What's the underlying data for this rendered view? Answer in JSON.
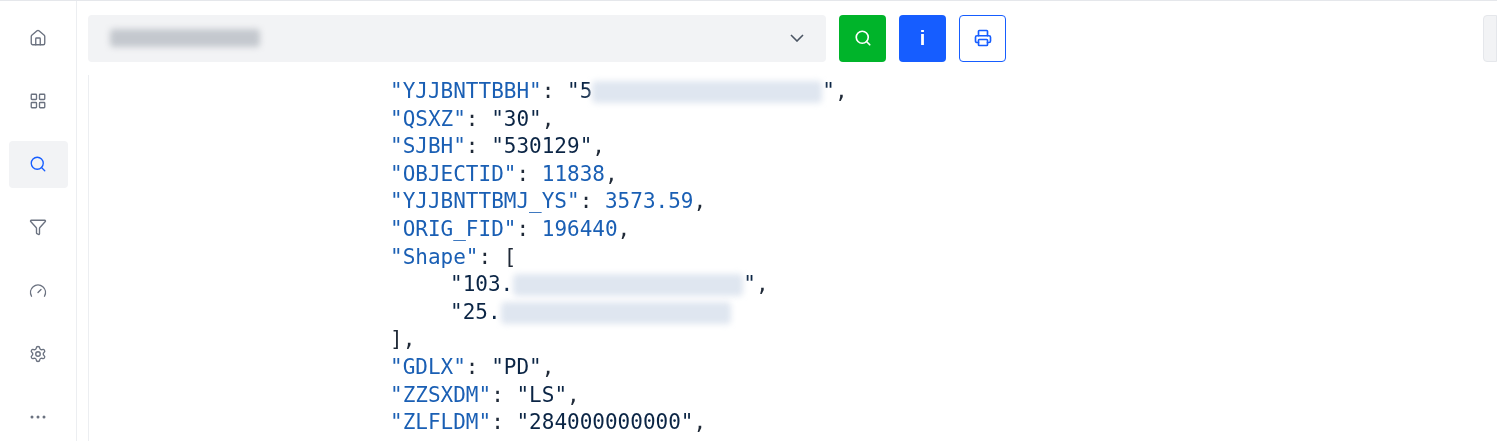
{
  "sidebar": {
    "items": [
      {
        "kind": "home",
        "selected": false
      },
      {
        "kind": "grid",
        "selected": false
      },
      {
        "kind": "search",
        "selected": true
      },
      {
        "kind": "filter",
        "selected": false
      },
      {
        "kind": "gauge",
        "selected": false
      },
      {
        "kind": "settings",
        "selected": false
      },
      {
        "kind": "more",
        "selected": false
      }
    ]
  },
  "toolbar": {
    "select": {
      "redacted": true
    },
    "buttons": [
      {
        "kind": "search"
      },
      {
        "kind": "info",
        "label": "i"
      },
      {
        "kind": "print"
      }
    ]
  },
  "code": {
    "lines": [
      {
        "segments": [
          {
            "kind": "key",
            "text": "\"YJJBNTTBBH\""
          },
          {
            "kind": "punct",
            "text": ": "
          },
          {
            "kind": "string",
            "text": "\"5"
          },
          {
            "kind": "redacted"
          },
          {
            "kind": "string",
            "text": "\""
          },
          {
            "kind": "punct",
            "text": ","
          }
        ]
      },
      {
        "segments": [
          {
            "kind": "key",
            "text": "\"QSXZ\""
          },
          {
            "kind": "punct",
            "text": ": "
          },
          {
            "kind": "string",
            "text": "\"30\""
          },
          {
            "kind": "punct",
            "text": ","
          }
        ]
      },
      {
        "segments": [
          {
            "kind": "key",
            "text": "\"SJBH\""
          },
          {
            "kind": "punct",
            "text": ": "
          },
          {
            "kind": "string",
            "text": "\"530129\""
          },
          {
            "kind": "punct",
            "text": ","
          }
        ]
      },
      {
        "segments": [
          {
            "kind": "key",
            "text": "\"OBJECTID\""
          },
          {
            "kind": "punct",
            "text": ": "
          },
          {
            "kind": "number",
            "text": "11838"
          },
          {
            "kind": "punct",
            "text": ","
          }
        ]
      },
      {
        "segments": [
          {
            "kind": "key",
            "text": "\"YJJBNTTBMJ_YS\""
          },
          {
            "kind": "punct",
            "text": ": "
          },
          {
            "kind": "number",
            "text": "3573.59"
          },
          {
            "kind": "punct",
            "text": ","
          }
        ]
      },
      {
        "segments": [
          {
            "kind": "key",
            "text": "\"ORIG_FID\""
          },
          {
            "kind": "punct",
            "text": ": "
          },
          {
            "kind": "number",
            "text": "196440"
          },
          {
            "kind": "punct",
            "text": ","
          }
        ]
      },
      {
        "segments": [
          {
            "kind": "key",
            "text": "\"Shape\""
          },
          {
            "kind": "punct",
            "text": ": ["
          }
        ],
        "children": [
          {
            "segments": [
              {
                "kind": "string",
                "text": "\"103."
              },
              {
                "kind": "redacted"
              },
              {
                "kind": "string",
                "text": "\""
              },
              {
                "kind": "punct",
                "text": ","
              }
            ]
          },
          {
            "segments": [
              {
                "kind": "string",
                "text": "\"25."
              },
              {
                "kind": "redacted"
              }
            ]
          }
        ]
      },
      {
        "segments": [
          {
            "kind": "punct",
            "text": "],"
          }
        ]
      },
      {
        "segments": [
          {
            "kind": "key",
            "text": "\"GDLX\""
          },
          {
            "kind": "punct",
            "text": ": "
          },
          {
            "kind": "string",
            "text": "\"PD\""
          },
          {
            "kind": "punct",
            "text": ","
          }
        ]
      },
      {
        "segments": [
          {
            "kind": "key",
            "text": "\"ZZSXDM\""
          },
          {
            "kind": "punct",
            "text": ": "
          },
          {
            "kind": "string",
            "text": "\"LS\""
          },
          {
            "kind": "punct",
            "text": ","
          }
        ]
      },
      {
        "segments": [
          {
            "kind": "key",
            "text": "\"ZLFLDM\""
          },
          {
            "kind": "punct",
            "text": ": "
          },
          {
            "kind": "string",
            "text": "\"284000000000\""
          },
          {
            "kind": "punct",
            "text": ","
          }
        ]
      }
    ]
  }
}
